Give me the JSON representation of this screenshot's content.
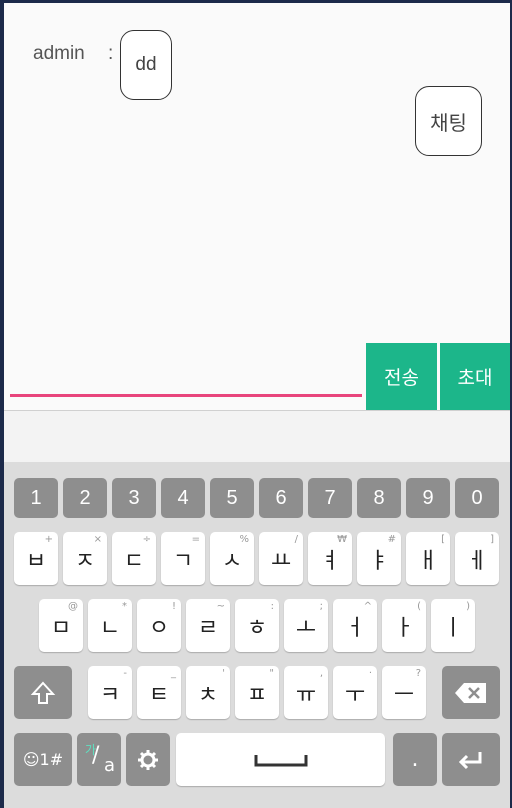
{
  "messages": {
    "sender": "admin",
    "separator": ":",
    "text": "dd"
  },
  "chat_bubble": "채팅",
  "input": {
    "value": "",
    "placeholder": ""
  },
  "buttons": {
    "send": "전송",
    "invite": "초대"
  },
  "keyboard": {
    "numbers": [
      "1",
      "2",
      "3",
      "4",
      "5",
      "6",
      "7",
      "8",
      "9",
      "0"
    ],
    "row1": [
      "ㅂ",
      "ㅈ",
      "ㄷ",
      "ㄱ",
      "ㅅ",
      "ㅛ",
      "ㅕ",
      "ㅑ",
      "ㅐ",
      "ㅔ"
    ],
    "row1_sub": [
      "+",
      "×",
      "÷",
      "=",
      "%",
      "/",
      "₩",
      "#",
      "[",
      "]"
    ],
    "row2": [
      "ㅁ",
      "ㄴ",
      "ㅇ",
      "ㄹ",
      "ㅎ",
      "ㅗ",
      "ㅓ",
      "ㅏ",
      "ㅣ"
    ],
    "row2_sub": [
      "@",
      "*",
      "!",
      "~",
      ":",
      ";",
      "^",
      "(",
      ")"
    ],
    "row3": [
      "ㅋ",
      "ㅌ",
      "ㅊ",
      "ㅍ",
      "ㅠ",
      "ㅜ",
      "ㅡ"
    ],
    "row3_sub": [
      "-",
      "_",
      "'",
      "\"",
      ",",
      "·",
      "?"
    ],
    "symbol_key": "☺1#",
    "lang_key_top": "가",
    "lang_key_bottom": "a",
    "period_key": "."
  }
}
